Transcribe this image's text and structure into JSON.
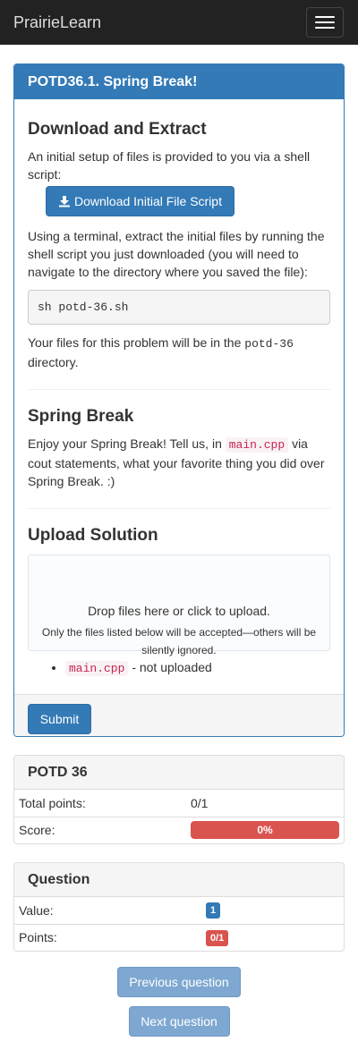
{
  "navbar": {
    "brand": "PrairieLearn"
  },
  "question_panel": {
    "title": "POTD36.1. Spring Break!",
    "section1": {
      "heading": "Download and Extract",
      "intro": "An initial setup of files is provided to you via a shell script:",
      "download_button": "Download Initial File Script",
      "instructions": "Using a terminal, extract the initial files by running the shell script you just downloaded (you will need to navigate to the directory where you saved the file):",
      "command": "sh potd-36.sh",
      "files_text_before": "Your files for this problem will be in the",
      "files_dir": "potd-36",
      "files_text_after": "directory."
    },
    "section2": {
      "heading": "Spring Break",
      "text_before": "Enjoy your Spring Break! Tell us, in",
      "file": "main.cpp",
      "text_after": "via cout statements, what your favorite thing you did over Spring Break. :)"
    },
    "section3": {
      "heading": "Upload Solution",
      "drop_main": "Drop files here or click to upload.",
      "drop_sub": "Only the files listed below will be accepted—others will be silently ignored.",
      "file_name": "main.cpp",
      "file_status": "- not uploaded"
    },
    "submit_label": "Submit"
  },
  "assessment_panel": {
    "title": "POTD 36",
    "total_points_label": "Total points:",
    "total_points_value": "0/1",
    "score_label": "Score:",
    "score_value": "0%",
    "score_fraction": 0
  },
  "question_info_panel": {
    "title": "Question",
    "value_label": "Value:",
    "value": "1",
    "points_label": "Points:",
    "points": "0/1"
  },
  "navigation": {
    "previous": "Previous question",
    "next": "Next question"
  },
  "colors": {
    "primary": "#337ab7",
    "danger": "#d9534f",
    "navbar": "#222222"
  }
}
